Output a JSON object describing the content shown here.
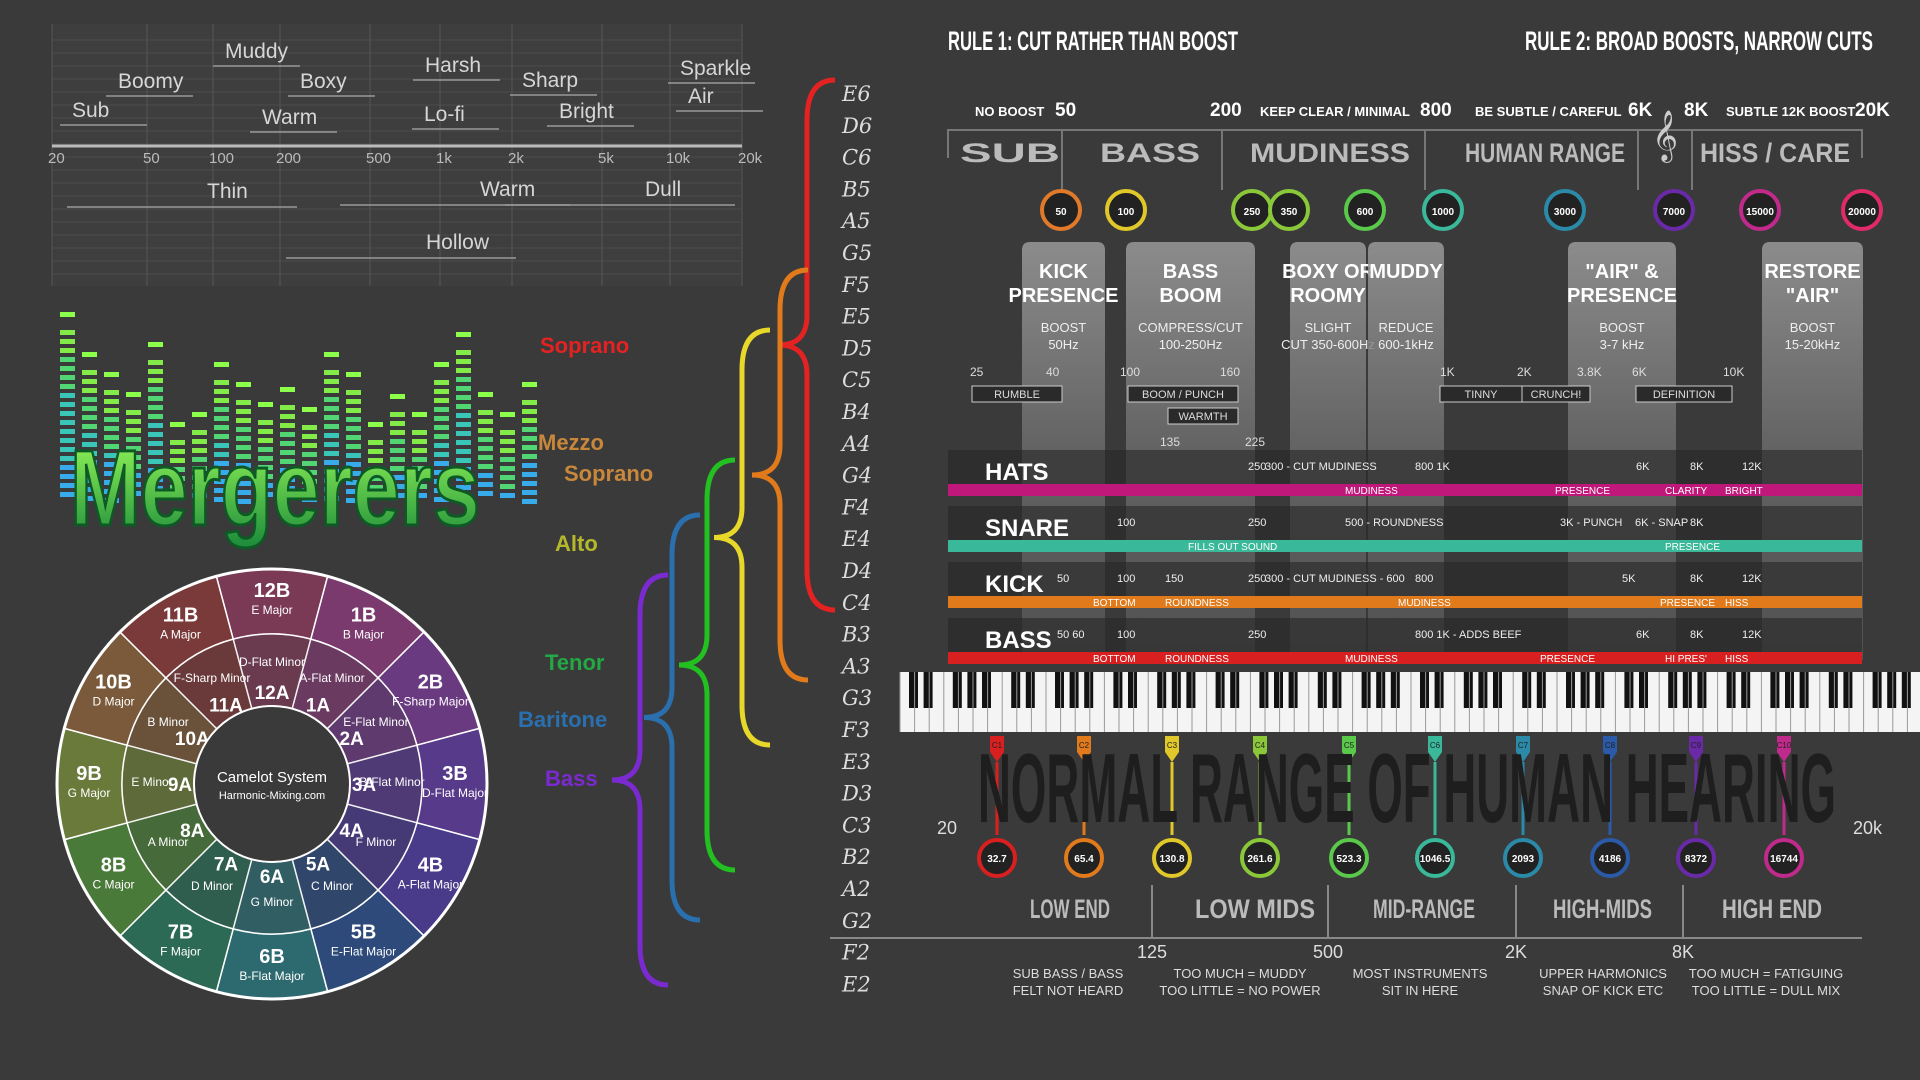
{
  "freq_words": {
    "axis_ticks": [
      "20",
      "50",
      "100",
      "200",
      "500",
      "1k",
      "2k",
      "5k",
      "10k",
      "20k"
    ],
    "upper": [
      "Muddy",
      "Boomy",
      "Boxy",
      "Harsh",
      "Sharp",
      "Sparkle",
      "Air",
      "Sub",
      "Warm",
      "Lo-fi",
      "Bright"
    ],
    "lower": [
      "Thin",
      "Warm",
      "Dull",
      "Hollow"
    ]
  },
  "logo": {
    "text": "Mergerers"
  },
  "camelot": {
    "center_title": "Camelot System",
    "center_sub": "Harmonic-Mixing.com",
    "outer": [
      {
        "code": "12B",
        "key": "E Major"
      },
      {
        "code": "1B",
        "key": "B Major"
      },
      {
        "code": "2B",
        "key": "F-Sharp Major"
      },
      {
        "code": "3B",
        "key": "D-Flat Major"
      },
      {
        "code": "4B",
        "key": "A-Flat Major"
      },
      {
        "code": "5B",
        "key": "E-Flat Major"
      },
      {
        "code": "6B",
        "key": "B-Flat Major"
      },
      {
        "code": "7B",
        "key": "F Major"
      },
      {
        "code": "8B",
        "key": "C Major"
      },
      {
        "code": "9B",
        "key": "G Major"
      },
      {
        "code": "10B",
        "key": "D Major"
      },
      {
        "code": "11B",
        "key": "A Major"
      }
    ],
    "inner": [
      {
        "code": "12A",
        "key": "D-Flat Minor"
      },
      {
        "code": "1A",
        "key": "A-Flat Minor"
      },
      {
        "code": "2A",
        "key": "E-Flat Minor"
      },
      {
        "code": "3A",
        "key": "B-Flat Minor"
      },
      {
        "code": "4A",
        "key": "F Minor"
      },
      {
        "code": "5A",
        "key": "C Minor"
      },
      {
        "code": "6A",
        "key": "G Minor"
      },
      {
        "code": "7A",
        "key": "D Minor"
      },
      {
        "code": "8A",
        "key": "A Minor"
      },
      {
        "code": "9A",
        "key": "E Minor"
      },
      {
        "code": "10A",
        "key": "B Minor"
      },
      {
        "code": "11A",
        "key": "F-Sharp Minor"
      }
    ],
    "colors": [
      "#7a3a55",
      "#7a3a6e",
      "#6a3a80",
      "#583a8a",
      "#4a3a8a",
      "#2d4a7a",
      "#2d6a70",
      "#2d6a55",
      "#4a7a3a",
      "#6a7a3a",
      "#7a5a3a",
      "#7a3a3a"
    ]
  },
  "voices": [
    {
      "name": "Soprano",
      "color": "#e52222"
    },
    {
      "name": "Mezzo",
      "color": "#c8873a"
    },
    {
      "name": "Soprano",
      "color": "#c8873a"
    },
    {
      "name": "Alto",
      "color": "#b5b82a"
    },
    {
      "name": "Tenor",
      "color": "#22a845"
    },
    {
      "name": "Baritone",
      "color": "#2a6fae"
    },
    {
      "name": "Bass",
      "color": "#7a2ad0"
    }
  ],
  "notes": [
    "E6",
    "D6",
    "C6",
    "B5",
    "A5",
    "G5",
    "F5",
    "E5",
    "D5",
    "C5",
    "B4",
    "A4",
    "G4",
    "F4",
    "E4",
    "D4",
    "C4",
    "B3",
    "A3",
    "G3",
    "F3",
    "E3",
    "D3",
    "C3",
    "B2",
    "A2",
    "G2",
    "F2",
    "E2"
  ],
  "eq": {
    "rule1": "RULE 1: CUT RATHER THAN BOOST",
    "rule2": "RULE 2: BROAD BOOSTS, NARROW CUTS",
    "top_labels": [
      "NO BOOST",
      "50",
      "200",
      "KEEP CLEAR / MINIMAL",
      "800",
      "BE SUBTLE / CAREFUL",
      "6K",
      "8K",
      "SUBTLE 12K BOOST",
      "20K"
    ],
    "bands": [
      "SUB",
      "BASS",
      "MUDINESS",
      "HUMAN RANGE",
      "HISS / CARE"
    ],
    "freq_circles": [
      {
        "v": "50",
        "c": "#e07a2a"
      },
      {
        "v": "100",
        "c": "#e0c82a"
      },
      {
        "v": "250",
        "c": "#8ac83a"
      },
      {
        "v": "350",
        "c": "#8ac83a"
      },
      {
        "v": "600",
        "c": "#5ac84a"
      },
      {
        "v": "1000",
        "c": "#3ab89a"
      },
      {
        "v": "3000",
        "c": "#2a8aa8"
      },
      {
        "v": "7000",
        "c": "#6a2aa8"
      },
      {
        "v": "15000",
        "c": "#c02a8a"
      },
      {
        "v": "20000",
        "c": "#e02a6a"
      }
    ],
    "panels": [
      {
        "title": "KICK PRESENCE",
        "sub": "BOOST 50Hz"
      },
      {
        "title": "BASS BOOM",
        "sub": "COMPRESS/CUT 100-250Hz"
      },
      {
        "title": "BOXY OR ROOMY",
        "sub": "SLIGHT CUT 350-600Hz"
      },
      {
        "title": "MUDDY",
        "sub": "REDUCE 600-1kHz"
      },
      {
        "title": "\"AIR\" & PRESENCE",
        "sub": "BOOST 3-7 kHz"
      },
      {
        "title": "RESTORE \"AIR\"",
        "sub": "BOOST 15-20kHz"
      }
    ],
    "mini_labels": [
      "25",
      "40",
      "100",
      "160",
      "135",
      "225",
      "1K",
      "2K",
      "3.8K",
      "6K",
      "10K"
    ],
    "mini_tags": [
      "RUMBLE",
      "BOOM / PUNCH",
      "WARMTH",
      "TINNY",
      "CRUNCH!",
      "DEFINITION"
    ],
    "instruments": [
      {
        "name": "HATS",
        "color": "#c0187a",
        "marks": [
          "250",
          "300 - CUT MUDINESS",
          "800 1K",
          "6K",
          "8K",
          "12K"
        ],
        "tags": [
          "MUDINESS",
          "PRESENCE",
          "CLARITY",
          "BRIGHT"
        ]
      },
      {
        "name": "SNARE",
        "color": "#3ab89a",
        "marks": [
          "100",
          "250",
          "500 - ROUNDNESS",
          "3K - PUNCH",
          "6K - SNAP",
          "8K"
        ],
        "tags": [
          "FILLS OUT SOUND",
          "PRESENCE"
        ]
      },
      {
        "name": "KICK",
        "color": "#e07a1a",
        "marks": [
          "50",
          "100",
          "150",
          "250",
          "300 - CUT MUDINESS - 600",
          "800",
          "5K",
          "8K",
          "12K"
        ],
        "tags": [
          "BOTTOM",
          "ROUNDNESS",
          "MUDINESS",
          "PRESENCE",
          "HISS"
        ]
      },
      {
        "name": "BASS",
        "color": "#d82020",
        "marks": [
          "50 60",
          "100",
          "250",
          "800 1K - ADDS BEEF",
          "6K",
          "8K",
          "12K"
        ],
        "tags": [
          "BOTTOM",
          "ROUNDNESS",
          "MUDINESS",
          "PRESENCE",
          "HI PRES'",
          "HISS"
        ]
      }
    ],
    "octaves": [
      "C1",
      "C2",
      "C3",
      "C4",
      "C5",
      "C6",
      "C7",
      "C8",
      "C9",
      "C10"
    ],
    "octave_colors": [
      "#d82020",
      "#e07a1a",
      "#e0c82a",
      "#8ac83a",
      "#5ac84a",
      "#3ab89a",
      "#2a8aa8",
      "#2a5aa8",
      "#6a2aa8",
      "#c02a8a"
    ],
    "hearing_title": "NORMAL RANGE OF HUMAN HEARING",
    "hearing_min": "20",
    "hearing_max": "20k",
    "octave_freqs": [
      "32.7",
      "65.4",
      "130.8",
      "261.6",
      "523.3",
      "1046.5",
      "2093",
      "4186",
      "8372",
      "16744"
    ],
    "ranges": [
      "LOW END",
      "LOW MIDS",
      "MID-RANGE",
      "HIGH-MIDS",
      "HIGH END"
    ],
    "range_edges": [
      "125",
      "500",
      "2K",
      "8K"
    ],
    "range_notes": [
      {
        "a": "SUB BASS / BASS",
        "b": "FELT NOT HEARD"
      },
      {
        "a": "TOO MUCH = MUDDY",
        "b": "TOO LITTLE = NO POWER"
      },
      {
        "a": "MOST INSTRUMENTS",
        "b": "SIT IN HERE"
      },
      {
        "a": "UPPER HARMONICS",
        "b": "SNAP OF KICK ETC"
      },
      {
        "a": "TOO MUCH = FATIGUING",
        "b": "TOO LITTLE = DULL MIX"
      }
    ]
  }
}
